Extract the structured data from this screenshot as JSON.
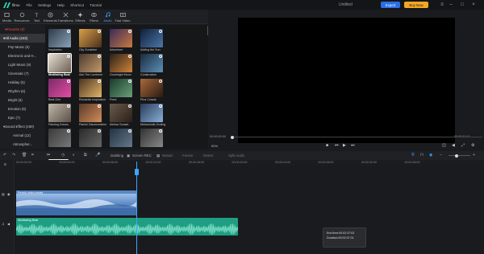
{
  "app": {
    "name": "filmo",
    "menu": [
      "File",
      "Settings",
      "Help",
      "Shortcut",
      "Tutorial"
    ],
    "document_title": "Untitled",
    "export_label": "Export",
    "buy_label": "Buy Now"
  },
  "toolbar": {
    "items": [
      {
        "label": "Media",
        "icon": "media-icon"
      },
      {
        "label": "Resources",
        "icon": "resources-icon"
      },
      {
        "label": "Text",
        "icon": "text-icon"
      },
      {
        "label": "Elements",
        "icon": "elements-icon"
      },
      {
        "label": "Transitions",
        "icon": "transitions-icon"
      },
      {
        "label": "Effects",
        "icon": "effects-icon"
      },
      {
        "label": "Filters",
        "icon": "filters-icon"
      },
      {
        "label": "Audio",
        "icon": "audio-icon",
        "active": true
      },
      {
        "label": "Fast Video",
        "icon": "fast-video-icon"
      }
    ]
  },
  "sidebar": {
    "items": [
      {
        "label": "Favorite (0)",
        "kind": "fav"
      },
      {
        "label": "All Audio (243)",
        "kind": "head",
        "selected": true
      },
      {
        "label": "Pop Music (6)"
      },
      {
        "label": "Electronic and H...",
        "kind": "expand"
      },
      {
        "label": "Light Music (9)"
      },
      {
        "label": "Cinematic (7)"
      },
      {
        "label": "Holiday (5)"
      },
      {
        "label": "Rhythm (6)"
      },
      {
        "label": "Bright (6)"
      },
      {
        "label": "Emotion (6)"
      },
      {
        "label": "Epic (7)"
      },
      {
        "label": "Sound Effect (190)",
        "kind": "head"
      },
      {
        "label": "Animal (12)",
        "kind": "sub"
      },
      {
        "label": "Atmospher...",
        "kind": "sub"
      }
    ]
  },
  "browser": {
    "rows": [
      [
        "Inspiration",
        "City Sunshine",
        "Adventure",
        "Adding the Sun"
      ],
      [
        "Meditating Beat",
        "Ask The Lumberer",
        "Goodnight Moon",
        "Construction"
      ],
      [
        "Beat One",
        "Romantic Inspiration",
        "Pond",
        "Pina Colada"
      ],
      [
        "Painting Dream",
        "Painful Disorientation",
        "Mellow Sunset",
        "Melancholic Ending"
      ],
      [
        "",
        "",
        "",
        ""
      ]
    ]
  },
  "preview": {
    "time_current": "00:00:00:00",
    "time_total": "00:00:10:11",
    "zoom": "50%"
  },
  "timeline": {
    "tools": [
      "Dubbing",
      "Screen REC",
      "Mosaic",
      "Freeze",
      "Detect",
      "Split Audio"
    ],
    "split_tooltip": "Split (Alt + S)",
    "ruler": [
      "00:00:00:00",
      "00:00:04:00",
      "00:00:08:00",
      "00:00:12:00",
      "00:00:16:00",
      "00:00:20:00",
      "00:00:24:00",
      "00:00:28:00",
      "00:00:32:00",
      "00:00:36:00"
    ],
    "video_clip_label": "Pexels-video-series",
    "audio_clip_label": "Meditating Beat",
    "tooltip_end": "End time:00:02:37:03",
    "tooltip_duration": "Duration:00:02:37:01"
  },
  "colors": {
    "accent": "#3fa4ff",
    "export": "#2b6ee8",
    "buy": "#f5a623",
    "audio_clip": "#1f9e83",
    "video_clip": "#5a88c6"
  }
}
